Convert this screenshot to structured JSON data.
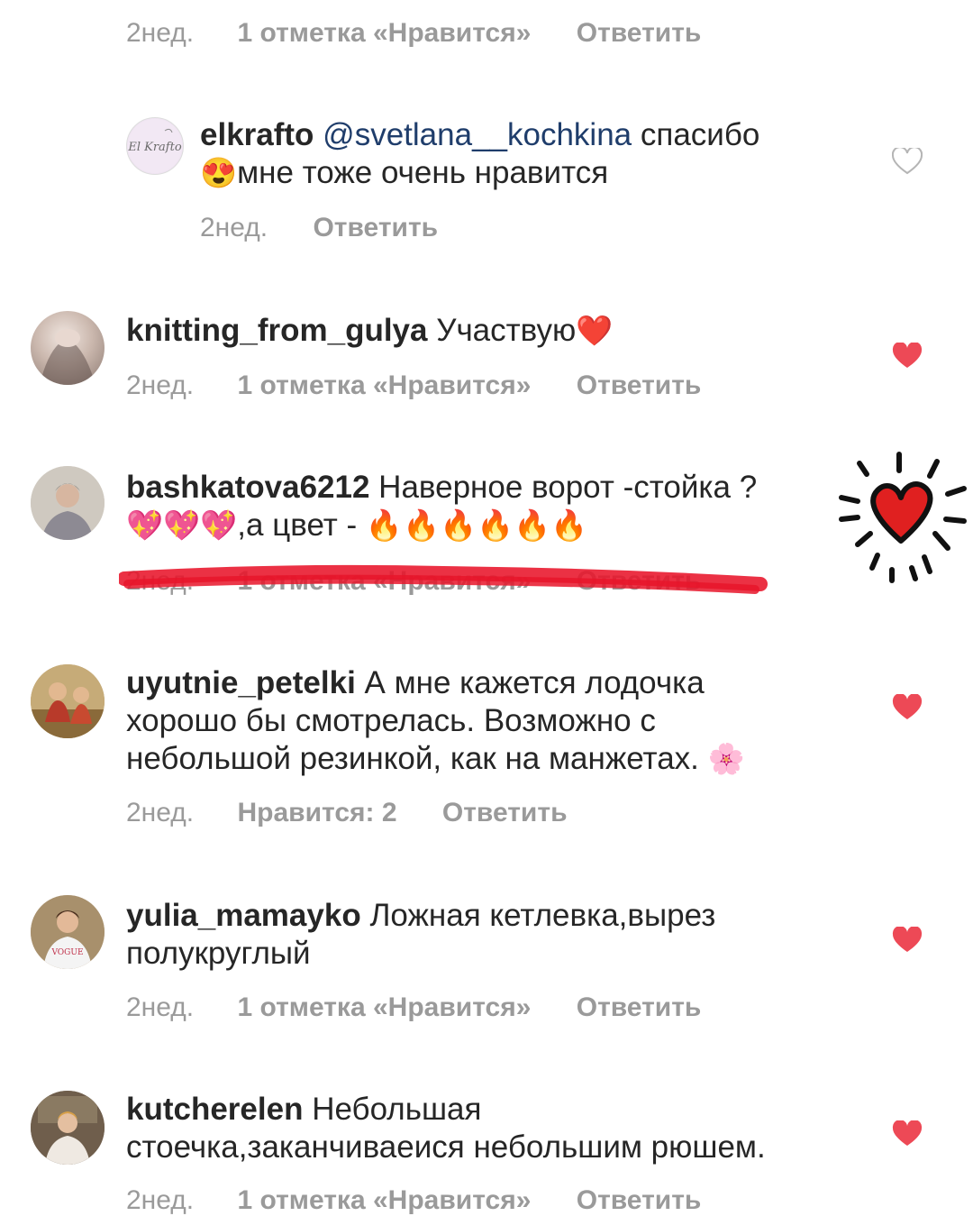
{
  "comments": [
    {
      "id": "c0",
      "time": "2нед.",
      "likes": "1 отметка «Нравится»",
      "reply": "Ответить"
    },
    {
      "id": "c1",
      "username": "elkrafto",
      "mention": "@svetlana__kochkina",
      "text_a": " спасибо",
      "emoji": "😍",
      "text_b": "мне тоже очень нравится",
      "time": "2нед.",
      "reply": "Ответить",
      "liked": false
    },
    {
      "id": "c2",
      "username": "knitting_from_gulya",
      "text": " Участвую",
      "emoji": "❤️",
      "time": "2нед.",
      "likes": "1 отметка «Нравится»",
      "reply": "Ответить",
      "liked": true
    },
    {
      "id": "c3",
      "username": "bashkatova6212",
      "text_a": " Наверное  ворот -стойка ?",
      "emoji_a": "💖💖💖",
      "text_b": ",а цвет -",
      "emoji_b": "🔥🔥🔥🔥🔥🔥",
      "time": "2нед.",
      "likes": "1 отметка «Нравится»",
      "reply": "Ответить"
    },
    {
      "id": "c4",
      "username": "uyutnie_petelki",
      "text_a": " А мне кажется лодочка",
      "text_b": "хорошо бы смотрелась. Возможно с",
      "text_c": "небольшой резинкой, как на манжетах.",
      "emoji": "🌸",
      "time": "2нед.",
      "likes": "Нравится: 2",
      "reply": "Ответить",
      "liked": true
    },
    {
      "id": "c5",
      "username": "yulia_mamayko",
      "text_a": " Ложная кетлевка,вырез",
      "text_b": "полукруглый",
      "time": "2нед.",
      "likes": "1 отметка «Нравится»",
      "reply": "Ответить",
      "liked": true
    },
    {
      "id": "c6",
      "username": "kutcherelen",
      "text_a": " Небольшая",
      "text_b": "стоечка,заканчиваеися небольшим рюшем.",
      "time": "2нед.",
      "likes": "1 отметка «Нравится»",
      "reply": "Ответить",
      "liked": true
    }
  ],
  "colors": {
    "heart_liked": "#ed4956",
    "meta_text": "#9a9a9a",
    "mention": "#1f3d6b",
    "highlight_stroke": "#e8152a",
    "doodle_heart": "#e02020"
  }
}
